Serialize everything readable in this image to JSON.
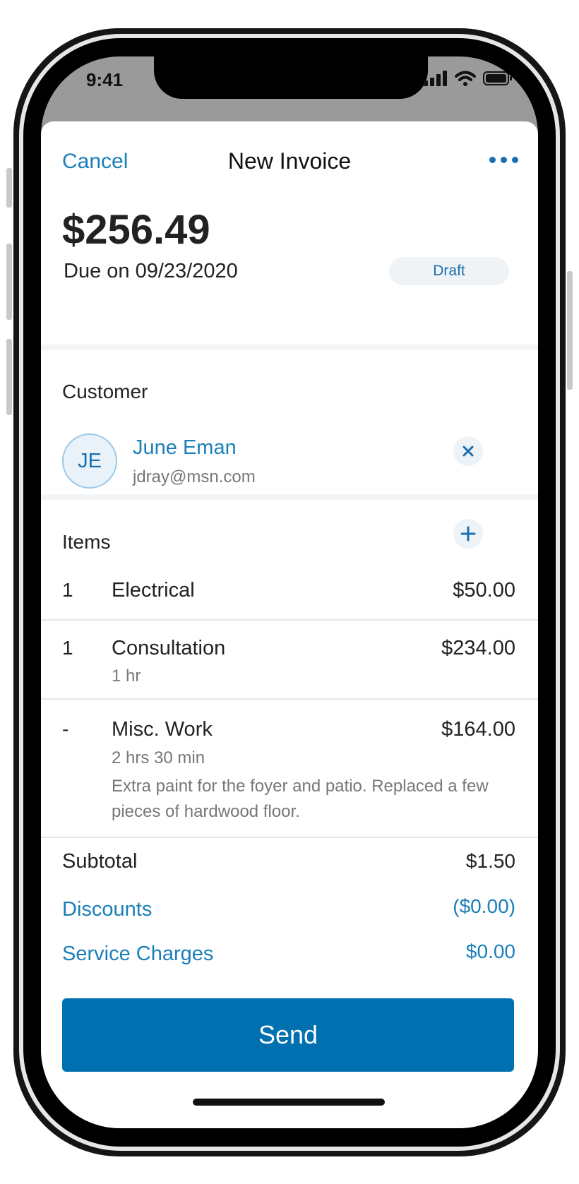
{
  "status_bar": {
    "time": "9:41"
  },
  "nav": {
    "cancel_label": "Cancel",
    "title": "New Invoice",
    "more_icon": "more-horizontal-icon"
  },
  "invoice": {
    "amount": "$256.49",
    "due": "Due on 09/23/2020",
    "status": "Draft"
  },
  "customer": {
    "section_label": "Customer",
    "initials": "JE",
    "name": "June Eman",
    "email": "jdray@msn.com",
    "remove_icon": "close-icon"
  },
  "items": {
    "section_label": "Items",
    "add_icon": "plus-icon",
    "list": [
      {
        "qty": "1",
        "name": "Electrical",
        "price": "$50.00",
        "detail": "",
        "note": ""
      },
      {
        "qty": "1",
        "name": "Consultation",
        "price": "$234.00",
        "detail": "1 hr",
        "note": ""
      },
      {
        "qty": "-",
        "name": "Misc. Work",
        "price": "$164.00",
        "detail": "2 hrs 30 min",
        "note": "Extra paint for the foyer and patio. Replaced a few pieces of hardwood floor."
      }
    ]
  },
  "totals": {
    "subtotal_label": "Subtotal",
    "subtotal_value": "$1.50",
    "discounts_label": "Discounts",
    "discounts_value": "($0.00)",
    "service_label": "Service Charges",
    "service_value": "$0.00"
  },
  "actions": {
    "send_label": "Send"
  },
  "colors": {
    "accent": "#1b7fba",
    "button": "#0070b0",
    "text": "#222222",
    "muted": "#777777"
  }
}
